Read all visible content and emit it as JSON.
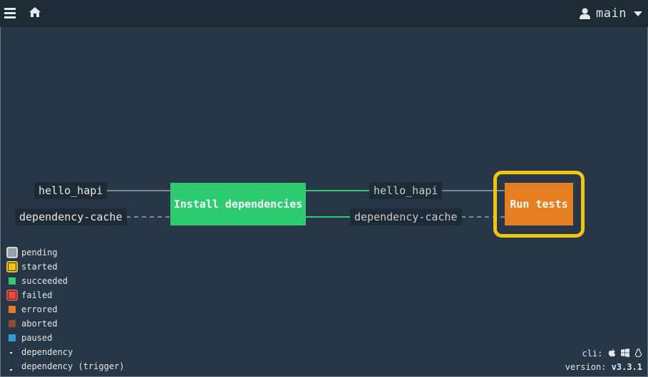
{
  "topbar": {
    "menu_icon": "hamburger-icon",
    "home_icon": "home-icon",
    "user_icon": "user-icon",
    "team_name": "main",
    "dropdown_icon": "caret-down-icon"
  },
  "pipeline": {
    "inputs_left": [
      {
        "name": "hello_hapi",
        "edge": "solid"
      },
      {
        "name": "dependency-cache",
        "edge": "dashed"
      }
    ],
    "job_install": {
      "name": "Install dependencies",
      "status": "succeeded"
    },
    "outputs_middle": [
      {
        "name": "hello_hapi",
        "edge": "solid"
      },
      {
        "name": "dependency-cache",
        "edge": "dashed"
      }
    ],
    "job_tests": {
      "name": "Run tests",
      "status": "errored",
      "running": "started"
    }
  },
  "legend": [
    {
      "label": "pending",
      "color": "#9aa1a8",
      "style": "ring",
      "ring_color": "#d1d5d8"
    },
    {
      "label": "started",
      "color": "#f1c40f",
      "style": "ring",
      "ring_color": "#f1c40f"
    },
    {
      "label": "succeeded",
      "color": "#2ecc71",
      "style": "square"
    },
    {
      "label": "failed",
      "color": "#e74c3c",
      "style": "ring",
      "ring_color": "#e74c3c"
    },
    {
      "label": "errored",
      "color": "#e67e22",
      "style": "square"
    },
    {
      "label": "aborted",
      "color": "#8f4b2d",
      "style": "square"
    },
    {
      "label": "paused",
      "color": "#3498db",
      "style": "square"
    },
    {
      "label": "dependency",
      "style": "dep"
    },
    {
      "label": "dependency (trigger)",
      "style": "dep-trigger"
    }
  ],
  "footer": {
    "cli_label": "cli:",
    "cli_icons": [
      "apple-icon",
      "windows-icon",
      "linux-icon"
    ],
    "version_label": "version:",
    "version": "v3.3.1"
  },
  "colors": {
    "bg": "#273747",
    "bar": "#1e2b37",
    "succeeded": "#2ecc71",
    "errored": "#e67e22",
    "started": "#f1c40f",
    "edge": "#808890"
  }
}
